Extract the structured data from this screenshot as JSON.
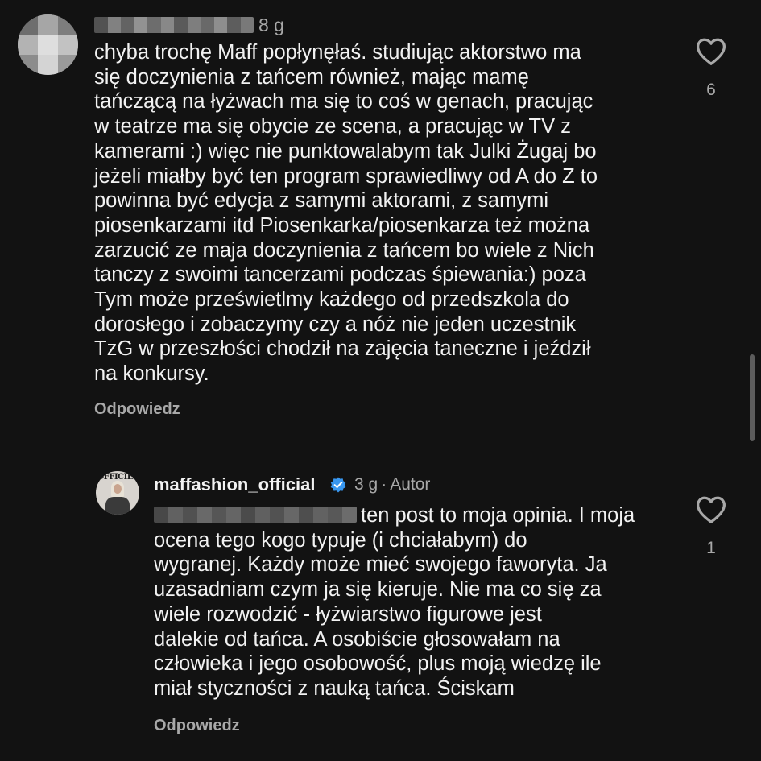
{
  "comment": {
    "time": "8 g",
    "text": "chyba trochę Maff popłynęłaś. studiując aktorstwo ma\nsię doczynienia z tańcem również, mając mamę\ntańczącą na łyżwach ma się to coś w genach, pracując\nw teatrze ma się obycie ze scena, a pracując w TV z\nkamerami :) więc nie punktowalabym tak Julki Żugaj bo\njeżeli miałby być ten program sprawiedliwy od A do Z to\npowinna być edycja z samymi aktorami, z samymi\npiosenkarzami itd Piosenkarka/piosenkarza też można\nzarzucić ze maja doczynienia z tańcem bo wiele z Nich\ntanczy z swoimi tancerzami podczas śpiewania:) poza\nTym może prześwietlmy każdego od przedszkola do\ndorosłego i zobaczymy czy a nóż nie jeden uczestnik\nTzG w przeszłości chodził na zajęcia taneczne  i jeździł\nna konkursy.",
    "reply_label": "Odpowiedz",
    "likes": "6"
  },
  "reply": {
    "username": "maffashion_official",
    "time": "3 g",
    "separator": "·",
    "author_badge": "Autor",
    "avatar_text": "OFFICIEL",
    "text": "ten post to moja opinia. I moja\nocena tego kogo typuje (i chciałabym) do\nwygranej. Każdy może mieć swojego faworyta. Ja\nuzasadniam czym ja się kieruje. Nie ma co się za\nwiele rozwodzić - łyżwiarstwo figurowe jest\ndalekie od tańca. A osobiście głosowałam na\nczłowieka i jego osobowość, plus moją wiedzę ile\nmiał styczności z nauką tańca. Ściskam",
    "reply_label": "Odpowiedz",
    "likes": "1"
  },
  "icons": {
    "like": "heart-outline-icon",
    "verified": "verified-badge-icon"
  },
  "colors": {
    "background": "#121212",
    "text": "#f2f2f2",
    "secondary_text": "#a8a8a8",
    "verified": "#3897f0"
  }
}
